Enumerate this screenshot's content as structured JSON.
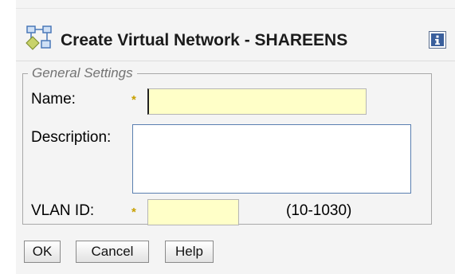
{
  "dialog": {
    "title": "Create Virtual Network - SHAREENS",
    "title_icon": "network-icon",
    "info_icon": "info-icon"
  },
  "general_settings": {
    "legend": "General Settings",
    "name": {
      "label": "Name:",
      "required_marker": "*",
      "value": ""
    },
    "description": {
      "label": "Description:",
      "value": ""
    },
    "vlan_id": {
      "label": "VLAN ID:",
      "required_marker": "*",
      "value": "",
      "range_hint": "(10-1030)"
    }
  },
  "buttons": {
    "ok": "OK",
    "cancel": "Cancel",
    "help": "Help"
  },
  "colors": {
    "required_field_bg": "#ffffc8",
    "required_marker": "#c8a000",
    "info_icon_bg": "#3a5f9c"
  }
}
